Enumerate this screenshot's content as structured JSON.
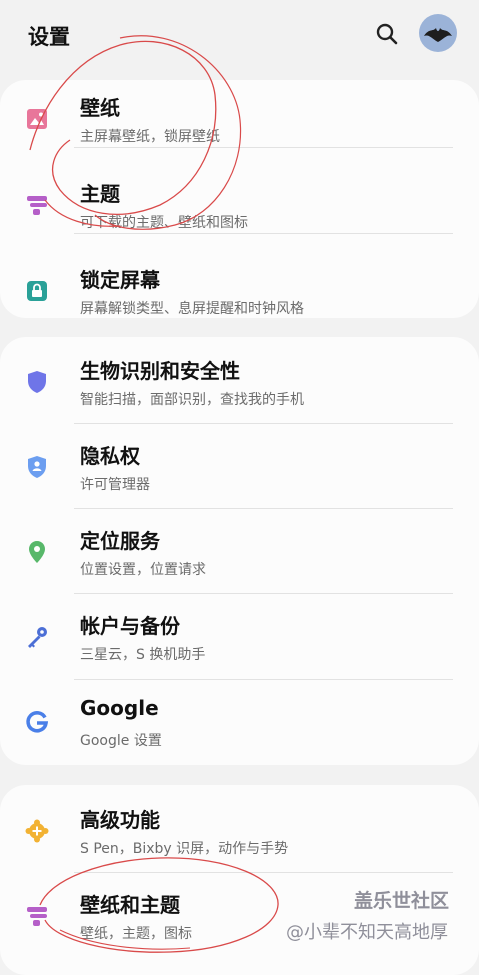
{
  "header": {
    "title": "设置",
    "search_icon": "search-icon",
    "avatar_icon": "bat-avatar"
  },
  "sections": [
    {
      "items": [
        {
          "title": "壁纸",
          "subtitle": "主屏幕壁纸，锁屏壁纸",
          "icon": "wallpaper-icon",
          "color": "#e8769a"
        },
        {
          "title": "主题",
          "subtitle": "可下载的主题、壁纸和图标",
          "icon": "theme-icon",
          "color": "#b55fc8"
        },
        {
          "title": "锁定屏幕",
          "subtitle": "屏幕解锁类型、息屏提醒和时钟风格",
          "icon": "lock-icon",
          "color": "#2aa198"
        }
      ]
    },
    {
      "items": [
        {
          "title": "生物识别和安全性",
          "subtitle": "智能扫描，面部识别，查找我的手机",
          "icon": "shield-icon",
          "color": "#6f75e8"
        },
        {
          "title": "隐私权",
          "subtitle": "许可管理器",
          "icon": "privacy-shield-icon",
          "color": "#6c9ef0"
        },
        {
          "title": "定位服务",
          "subtitle": "位置设置，位置请求",
          "icon": "location-pin-icon",
          "color": "#58b86a"
        },
        {
          "title": "帐户与备份",
          "subtitle": "三星云，S 换机助手",
          "icon": "key-icon",
          "color": "#4c6fd6"
        },
        {
          "title": "Google",
          "subtitle": "Google 设置",
          "icon": "google-icon",
          "color": "#4a7fe8"
        }
      ]
    },
    {
      "items": [
        {
          "title": "高级功能",
          "subtitle": "S Pen，Bixby 识屏，动作与手势",
          "icon": "gear-plus-icon",
          "color": "#f2b233"
        },
        {
          "title": "壁纸和主题",
          "subtitle": "壁纸，主题，图标",
          "icon": "theme-icon",
          "color": "#b55fc8"
        }
      ]
    }
  ],
  "watermark": {
    "line1": "盖乐世社区",
    "line2": "@小辈不知天高地厚"
  }
}
